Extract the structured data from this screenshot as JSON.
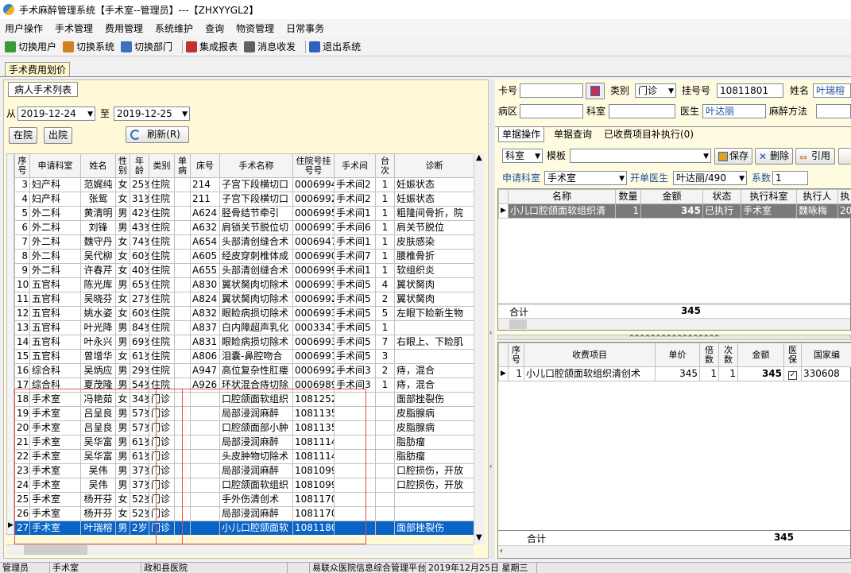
{
  "window": {
    "title": "手术麻醉管理系统【手术室--管理员】---【ZHXYYGL2】"
  },
  "menu": [
    "用户操作",
    "手术管理",
    "费用管理",
    "系统维护",
    "查询",
    "物资管理",
    "日常事务"
  ],
  "toolbar": [
    {
      "label": "切换用户",
      "icon": "users-icon",
      "color": "#3a9a3a"
    },
    {
      "label": "切换系统",
      "icon": "switch-system-icon",
      "color": "#d08020"
    },
    {
      "label": "切换部门",
      "icon": "department-icon",
      "color": "#4070c0"
    },
    {
      "label": "集成报表",
      "icon": "report-icon",
      "color": "#c03030"
    },
    {
      "label": "消息收发",
      "icon": "message-icon",
      "color": "#606060"
    },
    {
      "label": "退出系统",
      "icon": "exit-icon",
      "color": "#3060c0"
    }
  ],
  "main_tab": "手术费用划价",
  "left": {
    "tab": "病人手术列表",
    "from_label": "从",
    "from": "2019-12-24",
    "to_label": "至",
    "to": "2019-12-25",
    "in_btn": "在院",
    "out_btn": "出院",
    "refresh_btn": "刷新(R)",
    "headers": [
      "序号",
      "申请科室",
      "姓名",
      "性别",
      "年龄",
      "类别",
      "单病",
      "床号",
      "手术名称",
      "住院号挂号号",
      "手术间",
      "台次",
      "诊断"
    ],
    "rows": [
      [
        "3",
        "妇产科",
        "范娓纯",
        "女",
        "25岁",
        "住院",
        "",
        "214",
        "子宫下段横切口",
        "0006994",
        "手术间2",
        "1",
        "妊娠状态"
      ],
      [
        "4",
        "妇产科",
        "张鸳",
        "女",
        "31岁",
        "住院",
        "",
        "211",
        "子宫下段横切口",
        "0006992",
        "手术间2",
        "1",
        "妊娠状态"
      ],
      [
        "5",
        "外二科",
        "黄清明",
        "男",
        "42岁",
        "住院",
        "",
        "A624",
        "胫骨结节牵引",
        "0006995",
        "手术间1",
        "1",
        "粗隆间骨折，院"
      ],
      [
        "6",
        "外二科",
        "刘锋",
        "男",
        "43岁",
        "住院",
        "",
        "A632",
        "肩锁关节脱位切",
        "0006991",
        "手术间6",
        "1",
        "肩关节脱位"
      ],
      [
        "7",
        "外二科",
        "魏守丹",
        "女",
        "74岁",
        "住院",
        "",
        "A654",
        "头部清创缝合术",
        "0006947",
        "手术间1",
        "1",
        "皮肤感染"
      ],
      [
        "8",
        "外二科",
        "吴代柳",
        "女",
        "60岁",
        "住院",
        "",
        "A605",
        "经皮穿刺椎体成",
        "0006990",
        "手术间7",
        "1",
        "腰椎骨折"
      ],
      [
        "9",
        "外二科",
        "许春芹",
        "女",
        "40岁",
        "住院",
        "",
        "A655",
        "头部清创缝合术",
        "0006999",
        "手术间1",
        "1",
        "软组织炎"
      ],
      [
        "10",
        "五官科",
        "陈光库",
        "男",
        "65岁",
        "住院",
        "",
        "A830",
        "翼状胬肉切除术",
        "0006993",
        "手术间5",
        "4",
        "翼状胬肉"
      ],
      [
        "11",
        "五官科",
        "吴晓芬",
        "女",
        "27岁",
        "住院",
        "",
        "A824",
        "翼状胬肉切除术",
        "0006992",
        "手术间5",
        "2",
        "翼状胬肉"
      ],
      [
        "12",
        "五官科",
        "姚水姿",
        "女",
        "60岁",
        "住院",
        "",
        "A832",
        "眼睑病损切除术",
        "0006993",
        "手术间5",
        "5",
        "左眼下睑新生物"
      ],
      [
        "13",
        "五官科",
        "叶光降",
        "男",
        "84岁",
        "住院",
        "",
        "A837",
        "白内障超声乳化",
        "0003341",
        "手术间5",
        "1",
        ""
      ],
      [
        "14",
        "五官科",
        "叶永兴",
        "男",
        "69岁",
        "住院",
        "",
        "A831",
        "眼睑病损切除术",
        "0006993",
        "手术间5",
        "7",
        "右眼上、下睑肌"
      ],
      [
        "15",
        "五官科",
        "曾增华",
        "女",
        "61岁",
        "住院",
        "",
        "A806",
        "泪囊-鼻腔吻合",
        "0006991",
        "手术间5",
        "3",
        ""
      ],
      [
        "16",
        "综合科",
        "吴炳应",
        "男",
        "29岁",
        "住院",
        "",
        "A947",
        "高位复杂性肛瘘",
        "0006992",
        "手术间3",
        "2",
        "痔，混合"
      ],
      [
        "17",
        "综合科",
        "夏茂隆",
        "男",
        "54岁",
        "住院",
        "",
        "A926",
        "环状混合痔切除",
        "0006989",
        "手术间3",
        "1",
        "痔，混合"
      ],
      [
        "18",
        "手术室",
        "冯艳茹",
        "女",
        "34岁",
        "门诊",
        "",
        "",
        "口腔颌面软组织",
        "1081252",
        "",
        "",
        "面部挫裂伤"
      ],
      [
        "19",
        "手术室",
        "吕呈良",
        "男",
        "57岁",
        "门诊",
        "",
        "",
        "局部浸润麻醉",
        "1081135",
        "",
        "",
        "皮脂腺病"
      ],
      [
        "20",
        "手术室",
        "吕呈良",
        "男",
        "57岁",
        "门诊",
        "",
        "",
        "口腔颌面部小肿",
        "1081135",
        "",
        "",
        "皮脂腺病"
      ],
      [
        "21",
        "手术室",
        "吴华富",
        "男",
        "61岁",
        "门诊",
        "",
        "",
        "局部浸润麻醉",
        "1081114",
        "",
        "",
        "脂肪瘤"
      ],
      [
        "22",
        "手术室",
        "吴华富",
        "男",
        "61岁",
        "门诊",
        "",
        "",
        "头皮肿物切除术",
        "1081114",
        "",
        "",
        "脂肪瘤"
      ],
      [
        "23",
        "手术室",
        "吴伟",
        "男",
        "37岁",
        "门诊",
        "",
        "",
        "局部浸润麻醉",
        "1081099",
        "",
        "",
        "口腔损伤，开放"
      ],
      [
        "24",
        "手术室",
        "吴伟",
        "男",
        "37岁",
        "门诊",
        "",
        "",
        "口腔颌面软组织",
        "1081099",
        "",
        "",
        "口腔损伤，开放"
      ],
      [
        "25",
        "手术室",
        "杨开芬",
        "女",
        "52岁",
        "门诊",
        "",
        "",
        "手外伤清创术",
        "1081170",
        "",
        "",
        ""
      ],
      [
        "26",
        "手术室",
        "杨开芬",
        "女",
        "52岁",
        "门诊",
        "",
        "",
        "局部浸润麻醉",
        "1081170",
        "",
        "",
        ""
      ],
      [
        "27",
        "手术室",
        "叶瑞榕",
        "男",
        "2岁",
        "门诊",
        "",
        "",
        "小儿口腔颌面软",
        "1081180",
        "",
        "",
        "面部挫裂伤"
      ]
    ]
  },
  "right": {
    "card_label": "卡号",
    "card": "",
    "class_label": "类别",
    "class": "门诊",
    "reg_label": "挂号号",
    "reg": "10811801",
    "name_label": "姓名",
    "name": "叶瑞榕",
    "area_label": "病区",
    "area": "",
    "dept_label": "科室",
    "dept": "",
    "doctor_label": "医生",
    "doctor": "叶达丽",
    "anes_label": "麻醉方法",
    "anes": "",
    "tabs": [
      "单据操作",
      "单据查询",
      "已收费项目补执行(0)"
    ],
    "dept_combo": "科室",
    "template_label": "模板",
    "template": "",
    "save_btn": "保存",
    "delete_btn": "删除",
    "cite_btn": "引用",
    "apply_dept_label": "申请科室",
    "apply_dept": "手术室",
    "bill_doctor_label": "开单医生",
    "bill_doctor": "叶达丽/490",
    "coef_label": "系数",
    "coef": "1",
    "top_headers": [
      "名称",
      "数量",
      "金额",
      "状态",
      "执行科室",
      "执行人",
      "执"
    ],
    "top_rows": [
      [
        "小儿口腔颌面软组织清",
        "1",
        "345",
        "已执行",
        "手术室",
        "魏咏梅",
        "20"
      ]
    ],
    "top_total_label": "合计",
    "top_total": "345",
    "bottom_headers": [
      "序号",
      "收费项目",
      "单价",
      "倍数",
      "次数",
      "金额",
      "医保",
      "国家编"
    ],
    "bottom_rows": [
      [
        "1",
        "小儿口腔颌面软组织清创术",
        "345",
        "1",
        "1",
        "345",
        "✓",
        "330608"
      ]
    ],
    "bottom_total_label": "合计",
    "bottom_total": "345"
  },
  "status": [
    "管理员",
    "手术室",
    "政和县医院",
    "",
    "易联众医院信息综合管理平台",
    "2019年12月25日 星期三"
  ]
}
